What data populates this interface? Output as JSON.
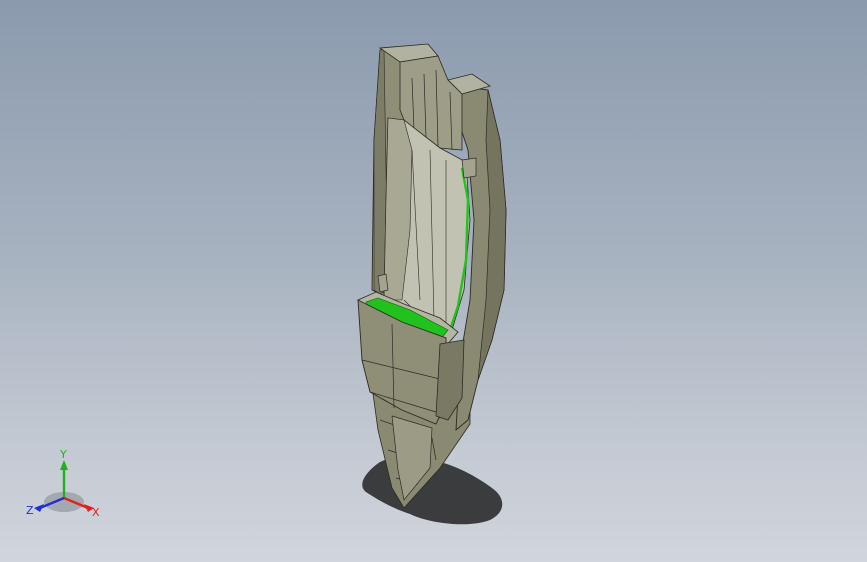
{
  "viewport": {
    "background_top": "#8b9aae",
    "background_bottom": "#d1d5dc"
  },
  "model": {
    "body_color": "#8f8f78",
    "face_light": "#c4c4b6",
    "face_mid": "#a9a996",
    "face_dark": "#74745f",
    "edge_color": "#2a2a22",
    "highlight_color": "#22c21e",
    "shadow_color": "#222222"
  },
  "triad": {
    "x_label": "X",
    "y_label": "Y",
    "z_label": "Z",
    "x_color": "#e02020",
    "y_color": "#20b020",
    "z_color": "#2030d0"
  }
}
